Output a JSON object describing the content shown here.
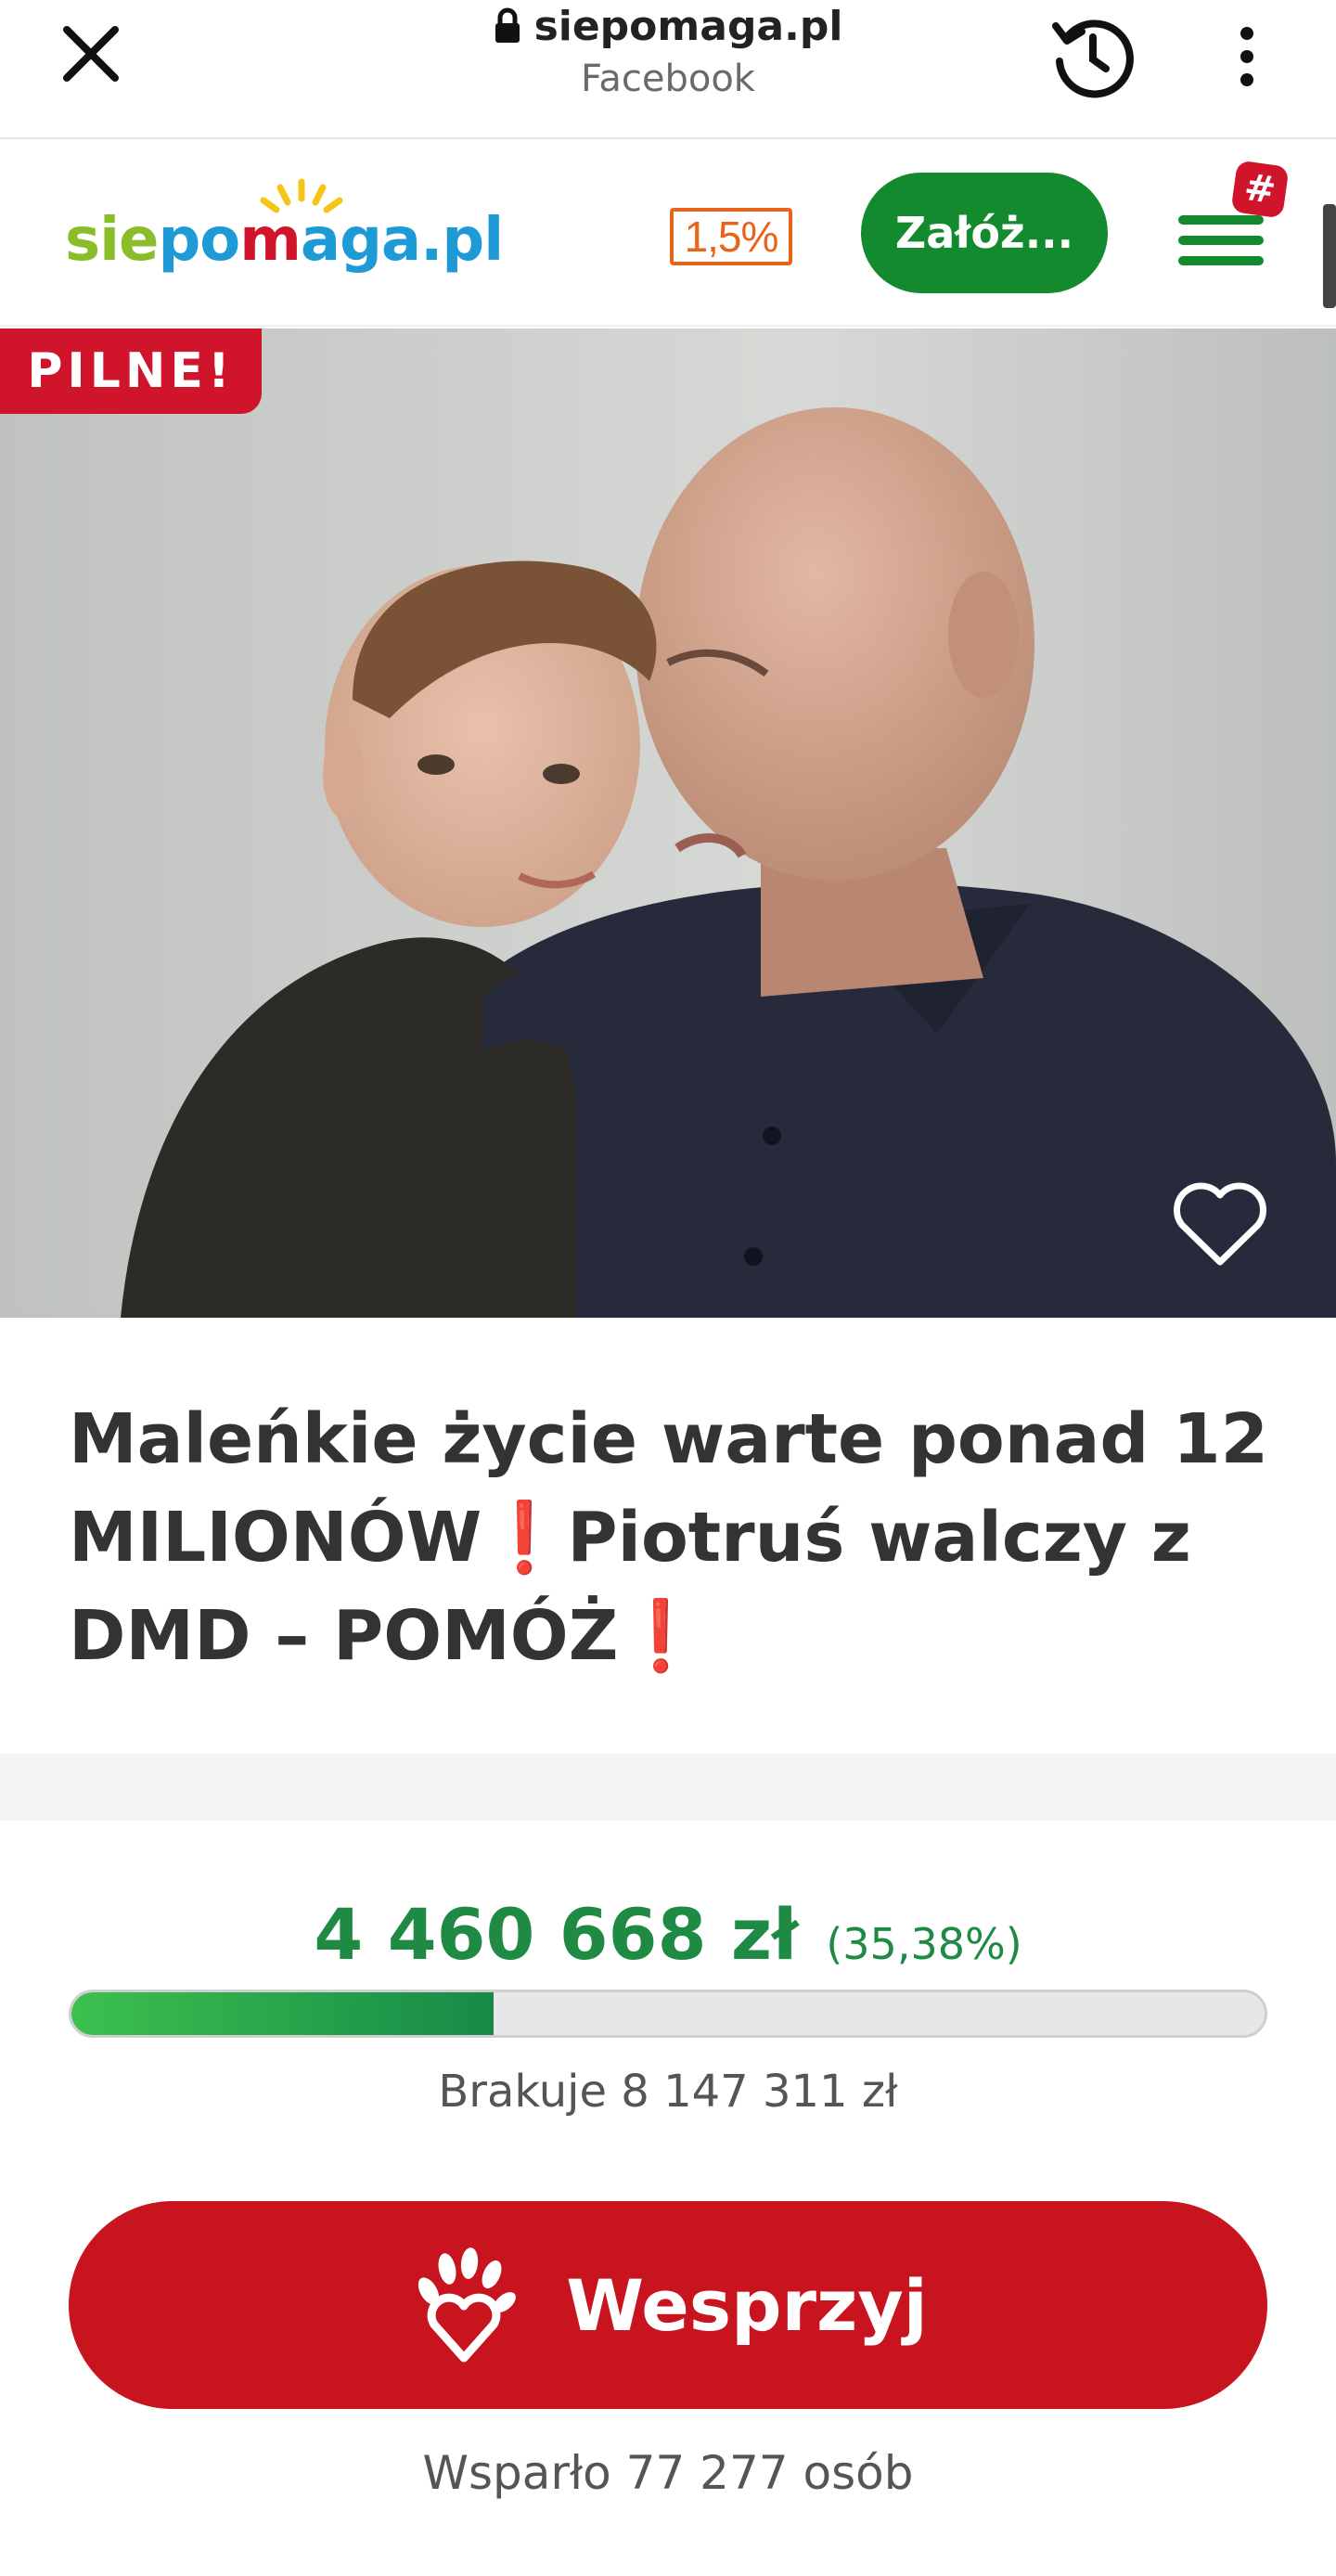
{
  "browser": {
    "url": "siepomaga.pl",
    "source": "Facebook"
  },
  "header": {
    "logo_text": [
      "sie",
      "po",
      "aga.pl"
    ],
    "logo_m": "m",
    "percent_badge": "1,5%",
    "cta_label": "Załóż...",
    "menu_badge": "#"
  },
  "badge": {
    "label": "PILNE!"
  },
  "fundraiser": {
    "title": "Maleńkie życie warte ponad 12 MILIONÓW❗Piotruś walczy z DMD – POMÓŻ❗",
    "raised": "4 460 668 zł",
    "raised_percent": "(35,38%)",
    "progress": 0.3538,
    "missing": "Brakuje 8 147 311 zł",
    "support_label": "Wesprzyj",
    "supporters": "Wsparło 77 277 osób"
  },
  "colors": {
    "brand_green": "#148a2e",
    "alert_red": "#d0142c",
    "amount_green": "#1e8a44"
  },
  "icons": [
    "close-icon",
    "lock-icon",
    "history-icon",
    "more-vert-icon",
    "hamburger-icon",
    "heart-outline-icon",
    "hand-heart-icon"
  ]
}
